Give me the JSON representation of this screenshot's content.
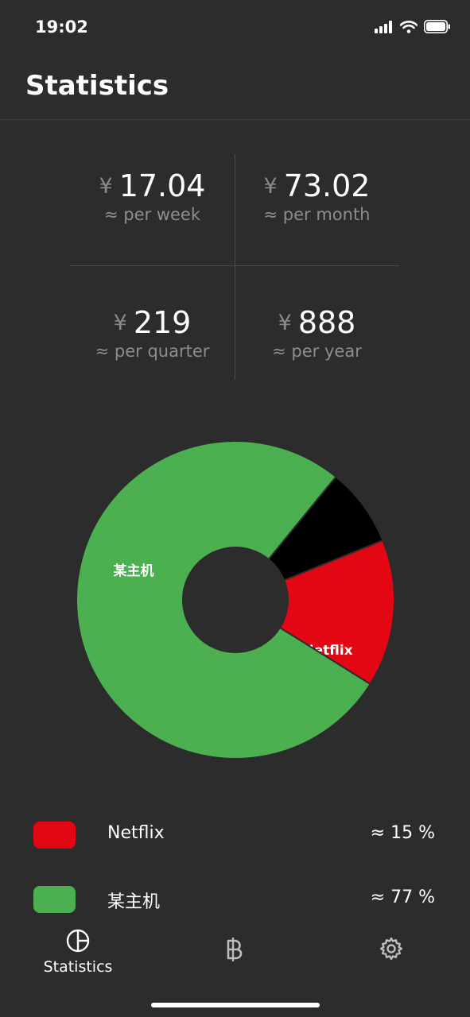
{
  "status_bar": {
    "time": "19:02"
  },
  "header": {
    "title": "Statistics"
  },
  "stats": [
    {
      "currency": "¥",
      "amount": "17.04",
      "label": "≈ per week"
    },
    {
      "currency": "¥",
      "amount": "73.02",
      "label": "≈ per month"
    },
    {
      "currency": "¥",
      "amount": "219",
      "label": "≈ per quarter"
    },
    {
      "currency": "¥",
      "amount": "888",
      "label": "≈ per year"
    }
  ],
  "chart_data": {
    "type": "pie",
    "donut": true,
    "categories": [
      "某主机",
      "Netflix",
      ""
    ],
    "values": [
      77,
      15,
      8
    ],
    "colors": [
      "#4caf50",
      "#e30613",
      "#000000"
    ],
    "slice_labels": [
      "某主机",
      "Netflix",
      ""
    ]
  },
  "legend": [
    {
      "name": "Netflix",
      "percent": "≈ 15 %",
      "color": "#e30613"
    },
    {
      "name": "某主机",
      "percent": "≈ 77 %",
      "color": "#4caf50"
    }
  ],
  "tab_bar": {
    "items": [
      {
        "label": "Statistics",
        "icon": "pie-chart-icon",
        "active": true
      },
      {
        "label": "",
        "icon": "baht-icon",
        "active": false
      },
      {
        "label": "",
        "icon": "gear-icon",
        "active": false
      }
    ]
  },
  "colors": {
    "background": "#2c2c2c",
    "divider": "#4a4a4a",
    "muted_text": "#8d8d8d",
    "primary_text": "#ffffff"
  }
}
